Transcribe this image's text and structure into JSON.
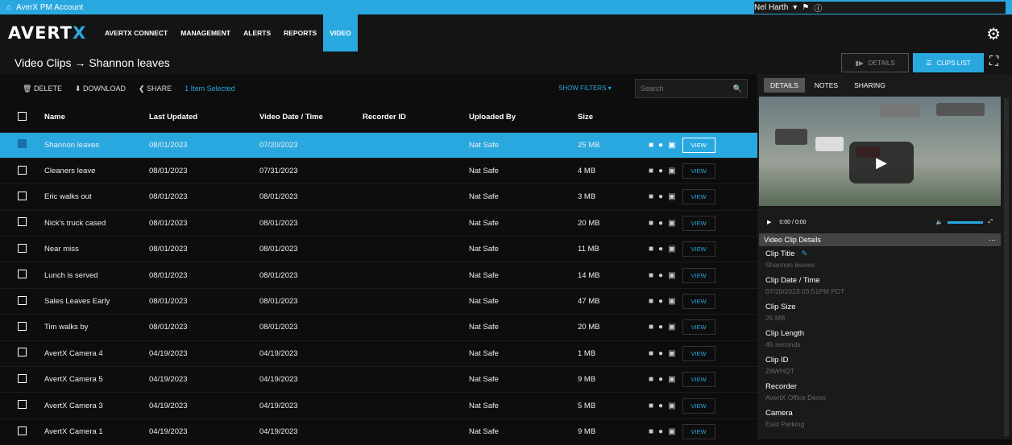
{
  "topbar": {
    "account": "AverX PM Account",
    "user": "Nel Harth"
  },
  "nav": {
    "logo": "AVERTX",
    "items": [
      "AVERTX CONNECT",
      "MANAGEMENT",
      "ALERTS",
      "REPORTS",
      "VIDEO"
    ],
    "active": "VIDEO"
  },
  "page": {
    "title": "Video Clips → Shannon leaves",
    "details_label": "DETAILS",
    "clips_list_label": "CLIPS LIST"
  },
  "toolbar": {
    "delete": "DELETE",
    "download": "DOWNLOAD",
    "share": "SHARE",
    "selected": "1 Item Selected",
    "show_filters": "SHOW FILTERS ▾",
    "search_placeholder": "Search"
  },
  "columns": [
    "Name",
    "Last Updated",
    "Video Date / Time",
    "Recorder ID",
    "Uploaded By",
    "Size"
  ],
  "view_label": "VIEW",
  "rows": [
    {
      "name": "Shannon leaves",
      "updated": "08/01/2023",
      "date": "07/20/2023",
      "recorder": "",
      "by": "Nat Safe",
      "size": "25 MB",
      "selected": true
    },
    {
      "name": "Cleaners leave",
      "updated": "08/01/2023",
      "date": "07/31/2023",
      "recorder": "",
      "by": "Nat Safe",
      "size": "4 MB",
      "selected": false
    },
    {
      "name": "Eric walks out",
      "updated": "08/01/2023",
      "date": "08/01/2023",
      "recorder": "",
      "by": "Nat Safe",
      "size": "3 MB",
      "selected": false
    },
    {
      "name": "Nick's truck cased",
      "updated": "08/01/2023",
      "date": "08/01/2023",
      "recorder": "",
      "by": "Nat Safe",
      "size": "20 MB",
      "selected": false
    },
    {
      "name": "Near miss",
      "updated": "08/01/2023",
      "date": "08/01/2023",
      "recorder": "",
      "by": "Nat Safe",
      "size": "11 MB",
      "selected": false
    },
    {
      "name": "Lunch is served",
      "updated": "08/01/2023",
      "date": "08/01/2023",
      "recorder": "",
      "by": "Nat Safe",
      "size": "14 MB",
      "selected": false
    },
    {
      "name": "Sales Leaves Early",
      "updated": "08/01/2023",
      "date": "08/01/2023",
      "recorder": "",
      "by": "Nat Safe",
      "size": "47 MB",
      "selected": false
    },
    {
      "name": "Tim walks by",
      "updated": "08/01/2023",
      "date": "08/01/2023",
      "recorder": "",
      "by": "Nat Safe",
      "size": "20 MB",
      "selected": false
    },
    {
      "name": "AvertX Camera 4",
      "updated": "04/19/2023",
      "date": "04/19/2023",
      "recorder": "",
      "by": "Nat Safe",
      "size": "1 MB",
      "selected": false
    },
    {
      "name": "AvertX Camera 5",
      "updated": "04/19/2023",
      "date": "04/19/2023",
      "recorder": "",
      "by": "Nat Safe",
      "size": "9 MB",
      "selected": false
    },
    {
      "name": "AvertX Camera 3",
      "updated": "04/19/2023",
      "date": "04/19/2023",
      "recorder": "",
      "by": "Nat Safe",
      "size": "5 MB",
      "selected": false
    },
    {
      "name": "AvertX Camera 1",
      "updated": "04/19/2023",
      "date": "04/19/2023",
      "recorder": "",
      "by": "Nat Safe",
      "size": "9 MB",
      "selected": false
    }
  ],
  "panel": {
    "tabs": [
      "DETAILS",
      "NOTES",
      "SHARING"
    ],
    "time": "0:00 / 0:00",
    "header": "Video Clip Details",
    "fields": [
      {
        "label": "Clip Title",
        "value": "Shannon leaves"
      },
      {
        "label": "Clip Date / Time",
        "value": "07/20/2023 03:51PM PDT"
      },
      {
        "label": "Clip Size",
        "value": "25 MB"
      },
      {
        "label": "Clip Length",
        "value": "45 seconds"
      },
      {
        "label": "Clip ID",
        "value": "Z6WHQT"
      },
      {
        "label": "Recorder",
        "value": "AvertX Office Demo"
      },
      {
        "label": "Camera",
        "value": "East Parking"
      }
    ]
  }
}
